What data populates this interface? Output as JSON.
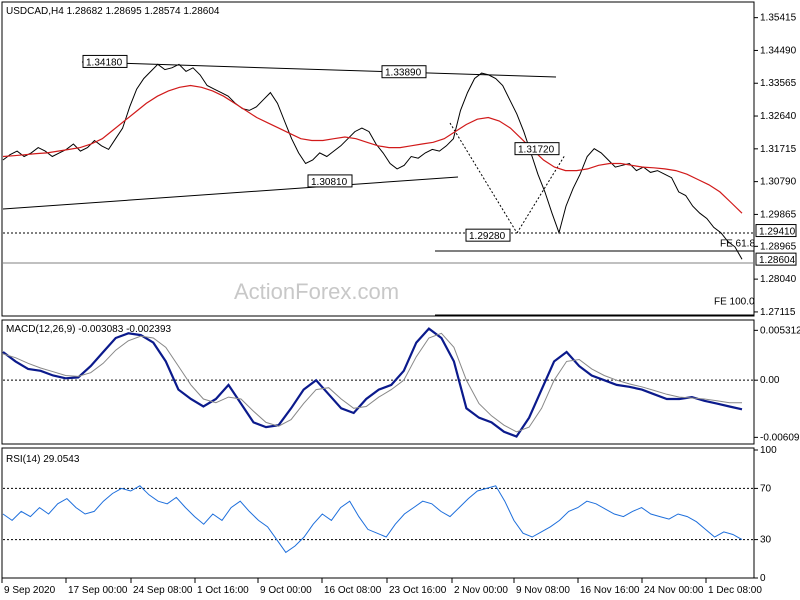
{
  "chart_data": [
    {
      "type": "line",
      "title": "USDCAD,H4  1.28682 1.28695 1.28574 1.28604",
      "yaxis_ticks": [
        "1.35415",
        "1.34490",
        "1.33565",
        "1.32640",
        "1.31715",
        "1.30790",
        "1.29865",
        "1.28965",
        "1.28040",
        "1.27115"
      ],
      "y_ticks_values": [
        1.35415,
        1.3449,
        1.33565,
        1.3264,
        1.31715,
        1.3079,
        1.29865,
        1.28965,
        1.2804,
        1.27115
      ],
      "ylim": [
        1.27,
        1.358
      ],
      "price_labels": [
        {
          "text": "1.34180",
          "value": 1.3418
        },
        {
          "text": "1.33890",
          "value": 1.3389
        },
        {
          "text": "1.31720",
          "value": 1.3172
        },
        {
          "text": "1.30810",
          "value": 1.3081
        },
        {
          "text": "1.29280",
          "value": 1.2928
        }
      ],
      "right_price_boxes": [
        {
          "text": "1.29410",
          "value": 1.2941
        },
        {
          "text": "1.28604",
          "value": 1.28604
        }
      ],
      "fib_labels": [
        {
          "text": "FE 61.8",
          "value": 1.2893
        },
        {
          "text": "FE 100.0",
          "value": 1.2719
        }
      ],
      "watermark": "ActionForex.com",
      "series": [
        {
          "color": "#000000",
          "values": [
            1.314,
            1.3155,
            1.3165,
            1.315,
            1.316,
            1.3175,
            1.3165,
            1.315,
            1.316,
            1.317,
            1.3185,
            1.3165,
            1.3175,
            1.3195,
            1.318,
            1.317,
            1.32,
            1.323,
            1.329,
            1.334,
            1.337,
            1.339,
            1.341,
            1.3395,
            1.34,
            1.341,
            1.339,
            1.34,
            1.338,
            1.335,
            1.334,
            1.333,
            1.332,
            1.33,
            1.3285,
            1.328,
            1.329,
            1.331,
            1.333,
            1.33,
            1.325,
            1.32,
            1.316,
            1.313,
            1.314,
            1.316,
            1.315,
            1.3165,
            1.318,
            1.32,
            1.322,
            1.323,
            1.322,
            1.3185,
            1.316,
            1.313,
            1.3115,
            1.3125,
            1.315,
            1.3145,
            1.316,
            1.317,
            1.3165,
            1.318,
            1.32,
            1.328,
            1.333,
            1.337,
            1.3385,
            1.338,
            1.337,
            1.335,
            1.331,
            1.327,
            1.322,
            1.316,
            1.31,
            1.305,
            1.299,
            1.2935,
            1.301,
            1.306,
            1.31,
            1.315,
            1.3172,
            1.316,
            1.314,
            1.312,
            1.3125,
            1.313,
            1.311,
            1.312,
            1.3105,
            1.311,
            1.31,
            1.309,
            1.305,
            1.304,
            1.301,
            1.299,
            1.2975,
            1.295,
            1.2935,
            1.291,
            1.2895,
            1.286
          ]
        },
        {
          "color": "#d11a1a",
          "values": [
            1.315,
            1.3152,
            1.3155,
            1.3158,
            1.316,
            1.3165,
            1.317,
            1.3175,
            1.3185,
            1.32,
            1.3225,
            1.325,
            1.3275,
            1.33,
            1.332,
            1.3335,
            1.3345,
            1.335,
            1.3345,
            1.3335,
            1.332,
            1.33,
            1.328,
            1.326,
            1.3245,
            1.323,
            1.3215,
            1.32,
            1.3195,
            1.3195,
            1.32,
            1.3205,
            1.32,
            1.319,
            1.318,
            1.3175,
            1.3175,
            1.318,
            1.3185,
            1.319,
            1.32,
            1.322,
            1.324,
            1.3255,
            1.326,
            1.325,
            1.323,
            1.32,
            1.317,
            1.314,
            1.312,
            1.311,
            1.311,
            1.3115,
            1.3125,
            1.313,
            1.313,
            1.3125,
            1.312,
            1.3118,
            1.3115,
            1.311,
            1.31,
            1.3085,
            1.307,
            1.305,
            1.302,
            1.299
          ]
        }
      ]
    },
    {
      "type": "line",
      "title": "MACD(12,26,9) -0.003083 -0.002393",
      "yaxis_ticks": [
        "0.005312",
        "0.00",
        "-0.006092"
      ],
      "y_ticks_values": [
        0.005312,
        0.0,
        -0.006092
      ],
      "ylim": [
        -0.0068,
        0.0062
      ],
      "series": [
        {
          "color": "#0b1a8c",
          "values": [
            0.003,
            0.002,
            0.0012,
            0.001,
            0.0005,
            0.0002,
            0.0003,
            0.0015,
            0.003,
            0.0045,
            0.005,
            0.0048,
            0.004,
            0.002,
            -0.001,
            -0.002,
            -0.0028,
            -0.002,
            -0.0005,
            -0.0025,
            -0.0045,
            -0.005,
            -0.0048,
            -0.003,
            -0.001,
            0.0,
            -0.0015,
            -0.003,
            -0.0035,
            -0.002,
            -0.001,
            -0.0005,
            0.001,
            0.004,
            0.0055,
            0.0045,
            0.002,
            -0.003,
            -0.004,
            -0.0045,
            -0.0055,
            -0.006,
            -0.004,
            -0.001,
            0.002,
            0.003,
            0.0015,
            0.0005,
            0.0,
            -0.0005,
            -0.0007,
            -0.001,
            -0.0015,
            -0.002,
            -0.002,
            -0.0018,
            -0.0022,
            -0.0025,
            -0.0028,
            -0.0031
          ]
        },
        {
          "color": "#888888",
          "values": [
            0.0028,
            0.0024,
            0.0018,
            0.0013,
            0.0009,
            0.0005,
            0.0004,
            0.0008,
            0.0018,
            0.0032,
            0.0042,
            0.0047,
            0.0045,
            0.0035,
            0.0015,
            -0.0005,
            -0.002,
            -0.0024,
            -0.0018,
            -0.002,
            -0.0033,
            -0.0045,
            -0.0049,
            -0.0042,
            -0.0025,
            -0.001,
            -0.0008,
            -0.002,
            -0.003,
            -0.0028,
            -0.0018,
            -0.001,
            0.0,
            0.0025,
            0.0045,
            0.005,
            0.0035,
            0.0,
            -0.0025,
            -0.0038,
            -0.0048,
            -0.0055,
            -0.005,
            -0.003,
            0.0,
            0.002,
            0.0022,
            0.0012,
            0.0005,
            0.0,
            -0.0004,
            -0.0007,
            -0.0011,
            -0.0015,
            -0.0018,
            -0.0019,
            -0.002,
            -0.0022,
            -0.0024,
            -0.0024
          ]
        }
      ]
    },
    {
      "type": "line",
      "title": "RSI(14) 29.0543",
      "yaxis_ticks": [
        "100",
        "70",
        "30",
        "0"
      ],
      "y_ticks_values": [
        100,
        70,
        30,
        0
      ],
      "ylim": [
        0,
        100
      ],
      "series": [
        {
          "color": "#1e6fdc",
          "values": [
            50,
            45,
            52,
            48,
            55,
            50,
            58,
            62,
            55,
            50,
            52,
            60,
            66,
            70,
            68,
            72,
            65,
            60,
            58,
            63,
            55,
            48,
            42,
            50,
            45,
            55,
            60,
            52,
            45,
            40,
            30,
            20,
            25,
            32,
            42,
            50,
            45,
            55,
            60,
            48,
            38,
            35,
            32,
            42,
            50,
            55,
            60,
            58,
            52,
            48,
            55,
            62,
            68,
            70,
            72,
            60,
            45,
            35,
            32,
            36,
            40,
            45,
            52,
            55,
            60,
            58,
            54,
            50,
            48,
            52,
            55,
            50,
            48,
            46,
            50,
            48,
            44,
            38,
            32,
            36,
            34,
            30
          ]
        }
      ]
    }
  ],
  "x_ticks": [
    "9 Sep 2020",
    "17 Sep 00:00",
    "24 Sep 08:00",
    "1 Oct 16:00",
    "9 Oct 00:00",
    "16 Oct 08:00",
    "23 Oct 16:00",
    "2 Nov 00:00",
    "9 Nov 08:00",
    "16 Nov 16:00",
    "24 Nov 00:00",
    "1 Dec 08:00"
  ]
}
